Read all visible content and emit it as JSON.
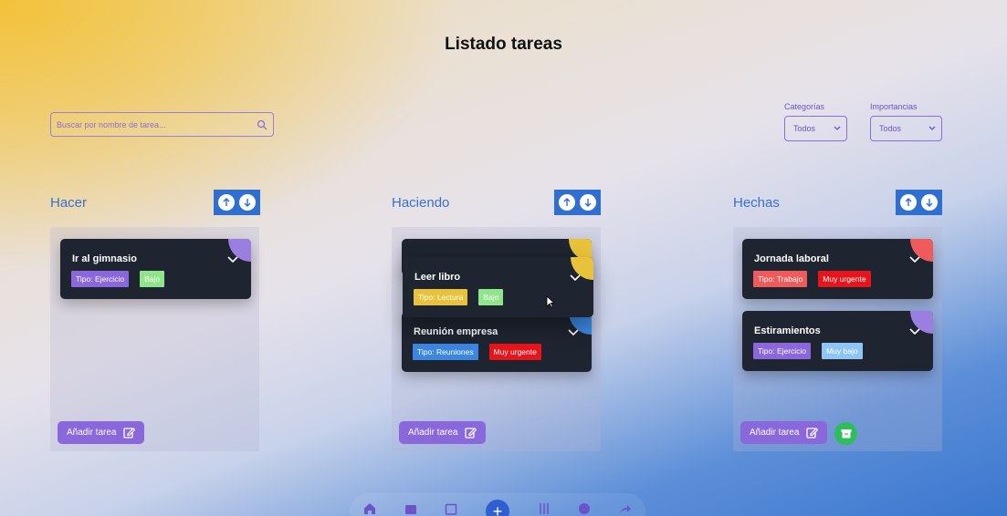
{
  "page": {
    "title": "Listado tareas"
  },
  "search": {
    "placeholder": "Buscar por nombre de tarea..."
  },
  "filters": {
    "categories": {
      "label": "Categorías",
      "value": "Todos"
    },
    "importance": {
      "label": "Importancias",
      "value": "Todos"
    }
  },
  "columns": [
    {
      "title": "Hacer",
      "add_label": "Añadir tarea",
      "cards": [
        {
          "title": "Ir al gimnasio",
          "type": "Tipo: Ejercicio",
          "priority": "Bajo",
          "corner": "#9b7fe0",
          "type_color": "#8a68dc",
          "priority_color": "#8ee58a"
        }
      ]
    },
    {
      "title": "Haciendo",
      "add_label": "Añadir tarea",
      "cards": [
        {
          "title": "Leer libro",
          "type": "Tipo: Lectura",
          "priority": "Bajo",
          "corner": "#e7c23a",
          "type_color": "#e7c23a",
          "priority_color": "#8ee58a"
        },
        {
          "title": "Reunión empresa",
          "type": "Tipo: Reuniones",
          "priority": "Muy urgente",
          "corner": "#3b86e0",
          "type_color": "#3b86e0",
          "priority_color": "#e8141b"
        }
      ]
    },
    {
      "title": "Hechas",
      "add_label": "Añadir tarea",
      "cards": [
        {
          "title": "Jornada laboral",
          "type": "Tipo: Trabajo",
          "priority": "Muy urgente",
          "corner": "#ef5a5a",
          "type_color": "#ef5a5a",
          "priority_color": "#e8141b"
        },
        {
          "title": "Estiramientos",
          "type": "Tipo: Ejercicio",
          "priority": "Muy bajo",
          "corner": "#9b7fe0",
          "type_color": "#8a68dc",
          "priority_color": "#8ec5f5"
        }
      ]
    }
  ]
}
